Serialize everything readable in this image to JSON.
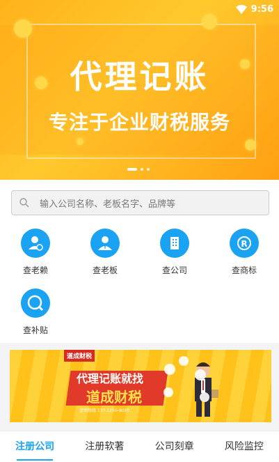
{
  "status": {
    "time": "9:56",
    "wifi_icon": "wifi-icon"
  },
  "banner": {
    "title": "代理记账",
    "subtitle": "专注于企业财税服务",
    "page_count": 3,
    "active_page": 1
  },
  "search": {
    "placeholder": "输入公司名称、老板名字、品牌等",
    "icon": "search-icon"
  },
  "quick_actions": [
    {
      "label": "查老赖",
      "icon": "debtor-person-icon"
    },
    {
      "label": "查老板",
      "icon": "boss-person-icon"
    },
    {
      "label": "查公司",
      "icon": "building-icon"
    },
    {
      "label": "查商标",
      "icon": "trademark-icon"
    },
    {
      "label": "查补贴",
      "icon": "subsidy-search-icon"
    }
  ],
  "ad": {
    "tag": "道成财税",
    "line1": "代理记账就找",
    "line2": "道成财税",
    "small": "咨询热线 137-1250-8060"
  },
  "tabs": [
    {
      "label": "注册公司",
      "active": true
    },
    {
      "label": "注册软著",
      "active": false
    },
    {
      "label": "公司刻章",
      "active": false
    },
    {
      "label": "风险监控",
      "active": false
    }
  ],
  "colors": {
    "accent": "#1aa3f2",
    "banner": "#ffb21a"
  }
}
